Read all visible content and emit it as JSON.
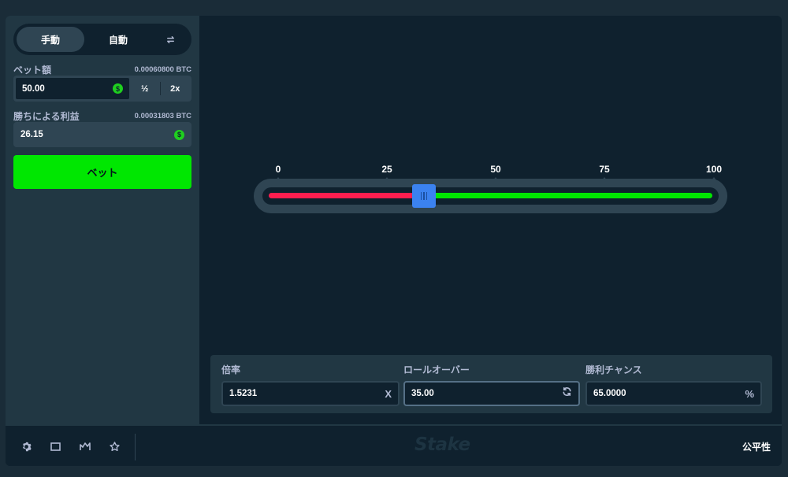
{
  "sidebar": {
    "mode": {
      "manual": "手動",
      "auto": "自動"
    },
    "bet_amount": {
      "label": "ベット額",
      "btc": "0.00060800 BTC",
      "value": "50.00",
      "half": "½",
      "double": "2x"
    },
    "profit": {
      "label": "勝ちによる利益",
      "btc": "0.00031803 BTC",
      "value": "26.15"
    },
    "bet_button": "ベット"
  },
  "slider": {
    "ticks": [
      "0",
      "25",
      "50",
      "75",
      "100"
    ],
    "value": 35.0,
    "min": 0,
    "max": 100,
    "colors": {
      "under": "#ff1e4f",
      "over": "#00e701",
      "handle": "#3b82f0"
    }
  },
  "stats": {
    "multiplier": {
      "label": "倍率",
      "value": "1.5231",
      "suffix": "X"
    },
    "roll_over": {
      "label": "ロールオーバー",
      "value": "35.00"
    },
    "win_chance": {
      "label": "勝利チャンス",
      "value": "65.0000",
      "suffix": "%"
    }
  },
  "footer": {
    "logo": "Stake",
    "fairness": "公平性"
  },
  "colors": {
    "accent": "#00e701",
    "panel": "#213743",
    "bg": "#0f212e"
  }
}
